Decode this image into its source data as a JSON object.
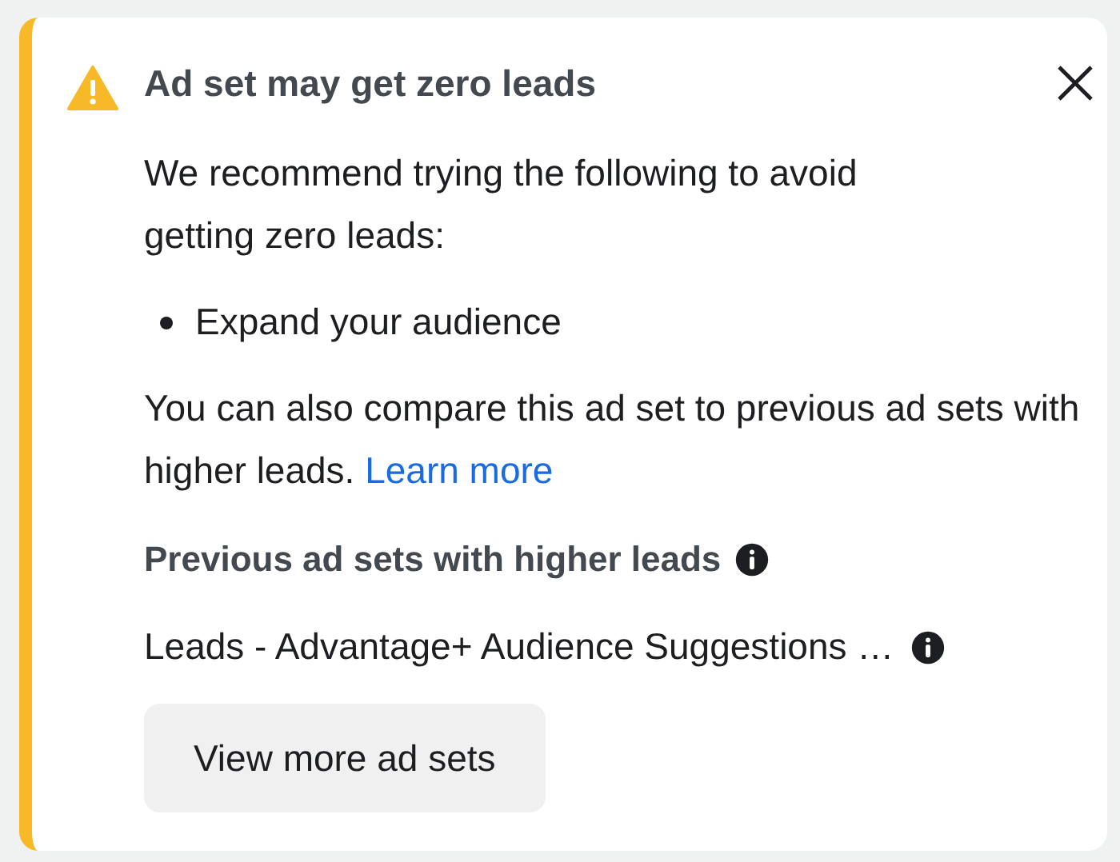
{
  "alert": {
    "kind": "warning",
    "title": "Ad set may get zero leads",
    "intro": "We recommend trying the following to avoid getting zero leads:",
    "suggestions": [
      "Expand your audience"
    ],
    "compare_text": "You can also compare this ad set to previous ad sets with higher leads.",
    "link": "Learn more",
    "section_title": "Previous ad sets with higher leads",
    "ad_sets": [
      "Leads - Advantage+ Audience Suggestions …"
    ],
    "button": "View more ad sets"
  }
}
